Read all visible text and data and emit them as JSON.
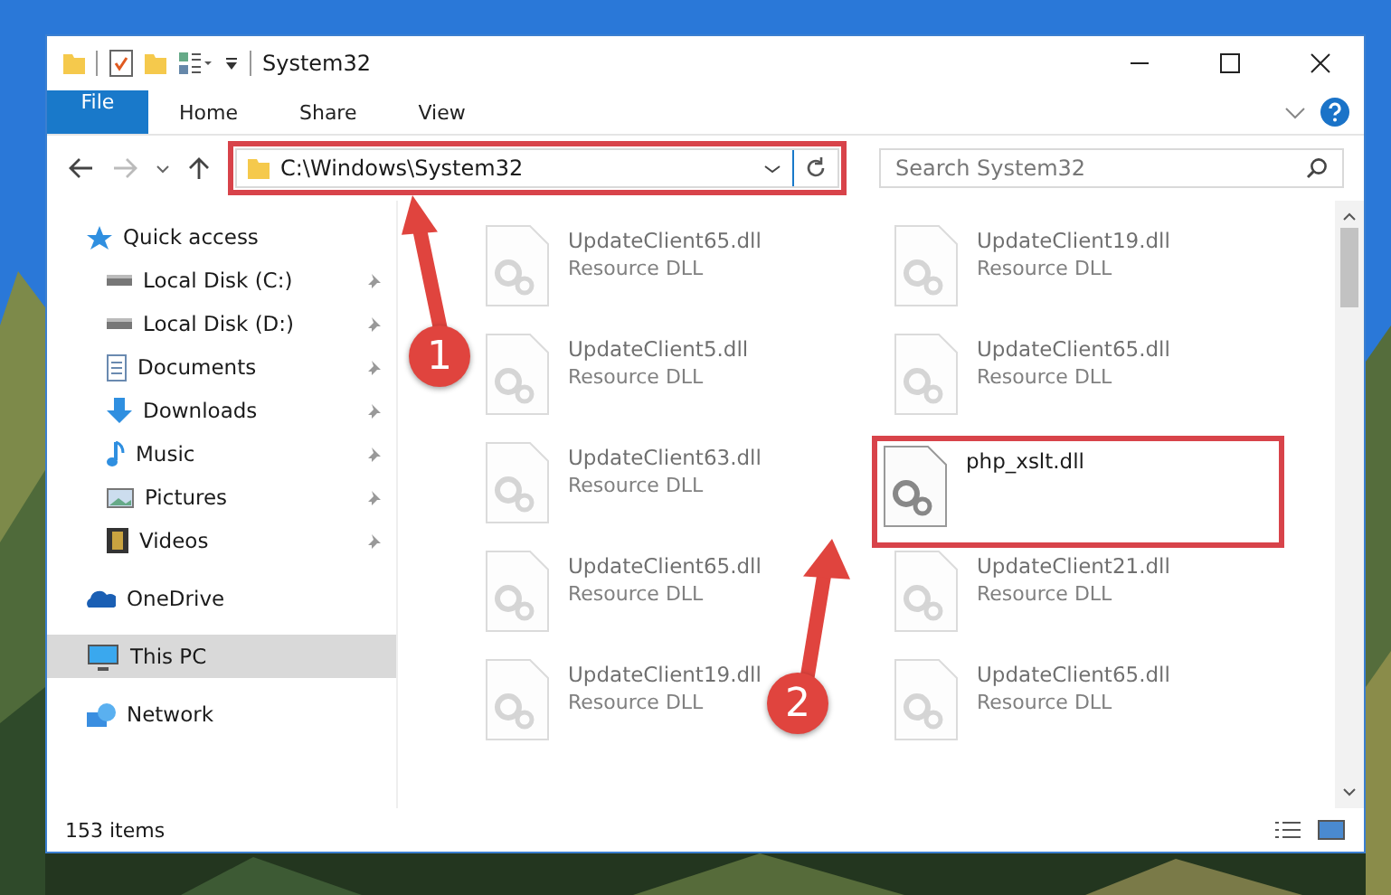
{
  "window": {
    "title": "System32"
  },
  "ribbon_tabs": [
    {
      "label": "File",
      "kind": "menu"
    },
    {
      "label": "Home",
      "kind": "tab"
    },
    {
      "label": "Share",
      "kind": "tab"
    },
    {
      "label": "View",
      "kind": "tab"
    }
  ],
  "address": {
    "path": "C:\\Windows\\System32"
  },
  "search": {
    "placeholder": "Search System32"
  },
  "nav": [
    {
      "label": "Quick access",
      "selected": false,
      "children": [
        {
          "label": "Local Disk (C:)",
          "pinned": true,
          "selected": false
        },
        {
          "label": "Local Disk (D:)",
          "pinned": true,
          "selected": false
        },
        {
          "label": "Documents",
          "pinned": true,
          "selected": false
        },
        {
          "label": "Downloads",
          "pinned": true,
          "selected": false
        },
        {
          "label": "Music",
          "pinned": true,
          "selected": false
        },
        {
          "label": "Pictures",
          "pinned": true,
          "selected": false
        },
        {
          "label": "Videos",
          "pinned": true,
          "selected": false
        }
      ]
    },
    {
      "label": "OneDrive",
      "selected": false
    },
    {
      "label": "This PC",
      "selected": true
    },
    {
      "label": "Network",
      "selected": false
    }
  ],
  "files": [
    {
      "name": "UpdateClient65.dll",
      "type": "Resource DLL",
      "blurred": true
    },
    {
      "name": "UpdateClient19.dll",
      "type": "Resource DLL",
      "blurred": true
    },
    {
      "name": "UpdateClient5.dll",
      "type": "Resource DLL",
      "blurred": true
    },
    {
      "name": "UpdateClient65.dll",
      "type": "Resource DLL",
      "blurred": true
    },
    {
      "name": "UpdateClient63.dll",
      "type": "Resource DLL",
      "blurred": true
    },
    {
      "name": "php_xslt.dll",
      "blurred": false
    },
    {
      "name": "UpdateClient65.dll",
      "type": "Resource DLL",
      "blurred": true
    },
    {
      "name": "UpdateClient21.dll",
      "type": "Resource DLL",
      "blurred": true
    },
    {
      "name": "UpdateClient19.dll",
      "type": "Resource DLL",
      "blurred": true
    },
    {
      "name": "UpdateClient65.dll",
      "type": "Resource DLL",
      "blurred": true
    }
  ],
  "status_bar": {
    "count": "153 items"
  },
  "annotations": [
    {
      "number": "1"
    },
    {
      "number": "2"
    }
  ]
}
